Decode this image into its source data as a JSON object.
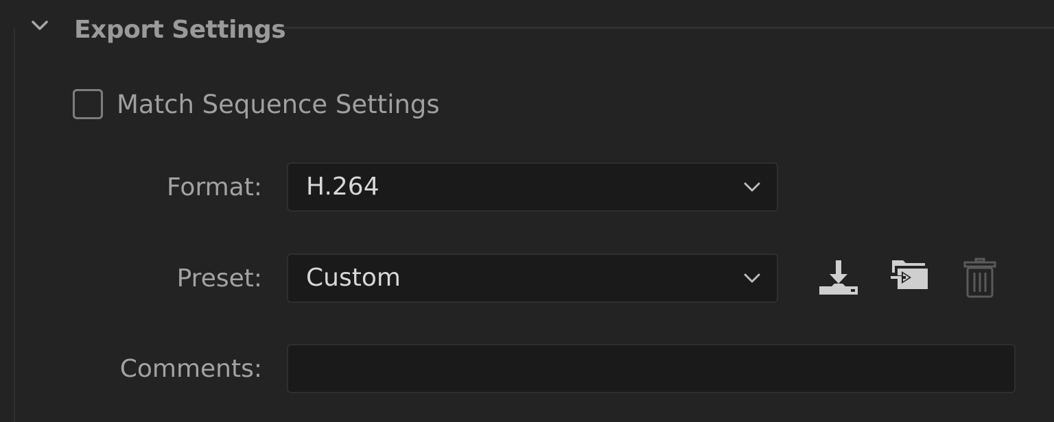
{
  "section": {
    "title": "Export Settings",
    "expanded": true
  },
  "match_sequence": {
    "label": "Match Sequence Settings",
    "checked": false
  },
  "format": {
    "label": "Format:",
    "value": "H.264"
  },
  "preset": {
    "label": "Preset:",
    "value": "Custom",
    "actions": [
      {
        "name": "save-preset",
        "icon": "download-tray-icon"
      },
      {
        "name": "import-preset",
        "icon": "folder-import-icon"
      },
      {
        "name": "delete-preset",
        "icon": "trash-icon",
        "disabled": true
      }
    ]
  },
  "comments": {
    "label": "Comments:",
    "value": "",
    "placeholder": ""
  },
  "colors": {
    "panel_bg": "#232323",
    "field_bg": "#1a1a1a",
    "text": "#d8d8d8",
    "label": "#a3a3a3",
    "icon": "#cfcfcf",
    "icon_disabled": "#5a5a5a"
  }
}
